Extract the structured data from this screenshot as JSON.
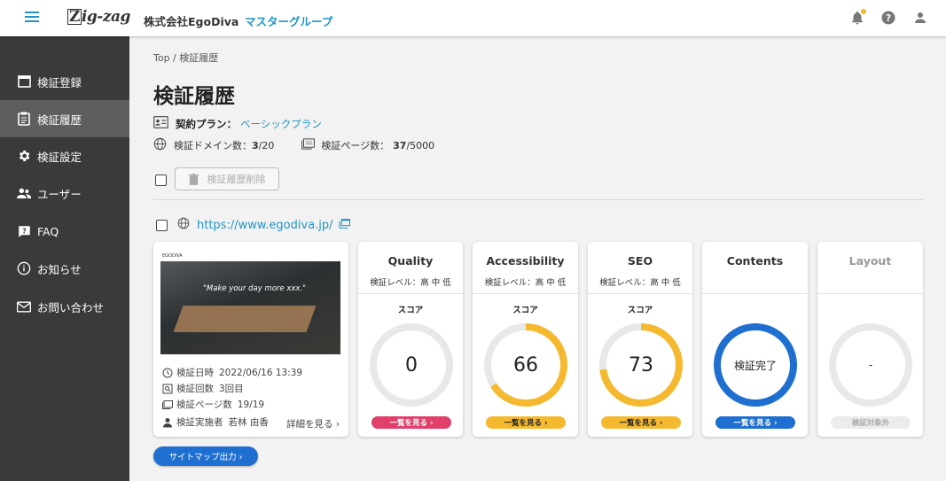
{
  "header": {
    "logo": "Zig-zag",
    "company": "株式会社EgoDiva",
    "group": "マスターグループ",
    "notification_dot_color": "#f2b722"
  },
  "sidebar": {
    "items": [
      {
        "label": "検証登録",
        "icon": "register-icon",
        "active": false
      },
      {
        "label": "検証履歴",
        "icon": "history-icon",
        "active": true
      },
      {
        "label": "検証設定",
        "icon": "gear-icon",
        "active": false
      },
      {
        "label": "ユーザー",
        "icon": "users-icon",
        "active": false
      },
      {
        "label": "FAQ",
        "icon": "faq-icon",
        "active": false
      },
      {
        "label": "お知らせ",
        "icon": "info-icon",
        "active": false
      },
      {
        "label": "お問い合わせ",
        "icon": "mail-icon",
        "active": false
      }
    ]
  },
  "main": {
    "breadcrumb": "Top / 検証履歴",
    "title": "検証履歴",
    "plan_label": "契約プラン：",
    "plan_value": "ベーシックプラン",
    "domain_label": "検証ドメイン数：",
    "domain_used": "3",
    "domain_total": "/20",
    "pages_label": "検証ページ数：",
    "pages_used": "37",
    "pages_total": "/5000",
    "delete_button": "検証履歴削除",
    "url": "https://www.egodiva.jp/"
  },
  "site_card": {
    "thumb_brand": "EGODIVA",
    "thumb_tagline": "\"Make your day more xxx.\"",
    "date_label": "検証日時",
    "date_value": "2022/06/16 13:39",
    "count_label": "検証回数",
    "count_value": "3回目",
    "pages_label": "検証ページ数",
    "pages_value": "19/19",
    "operator_label": "検証実施者",
    "operator_value": "若林 由香",
    "detail_link": "詳細を見る ›"
  },
  "metrics": [
    {
      "title": "Quality",
      "level": "検証レベル：高 中 低",
      "score_label": "スコア",
      "value": "0",
      "progress": 0,
      "ring_color": "#e8e8e8",
      "button": "一覧を見る ›",
      "button_color": "#e0406a",
      "button_text_color": "#ffffff"
    },
    {
      "title": "Accessibility",
      "level": "検証レベル：高 中 低",
      "score_label": "スコア",
      "value": "66",
      "progress": 66,
      "ring_color": "#f4b92f",
      "button": "一覧を見る ›",
      "button_color": "#f4b92f",
      "button_text_color": "#222222"
    },
    {
      "title": "SEO",
      "level": "検証レベル：高 中 低",
      "score_label": "スコア",
      "value": "73",
      "progress": 73,
      "ring_color": "#f4b92f",
      "button": "一覧を見る ›",
      "button_color": "#f4b92f",
      "button_text_color": "#222222"
    },
    {
      "title": "Contents",
      "level": "",
      "score_label": "",
      "value": "検証完了",
      "progress": 100,
      "ring_color": "#1f6fd1",
      "button": "一覧を見る ›",
      "button_color": "#1f6fd1",
      "button_text_color": "#ffffff"
    },
    {
      "title": "Layout",
      "level": "",
      "score_label": "",
      "value": "-",
      "progress": 0,
      "ring_color": "#e8e8e8",
      "button": "検証対象外",
      "button_color": "#ececec",
      "button_text_color": "#aaaaaa"
    }
  ],
  "sitemap_button": "サイトマップ出力 ›"
}
